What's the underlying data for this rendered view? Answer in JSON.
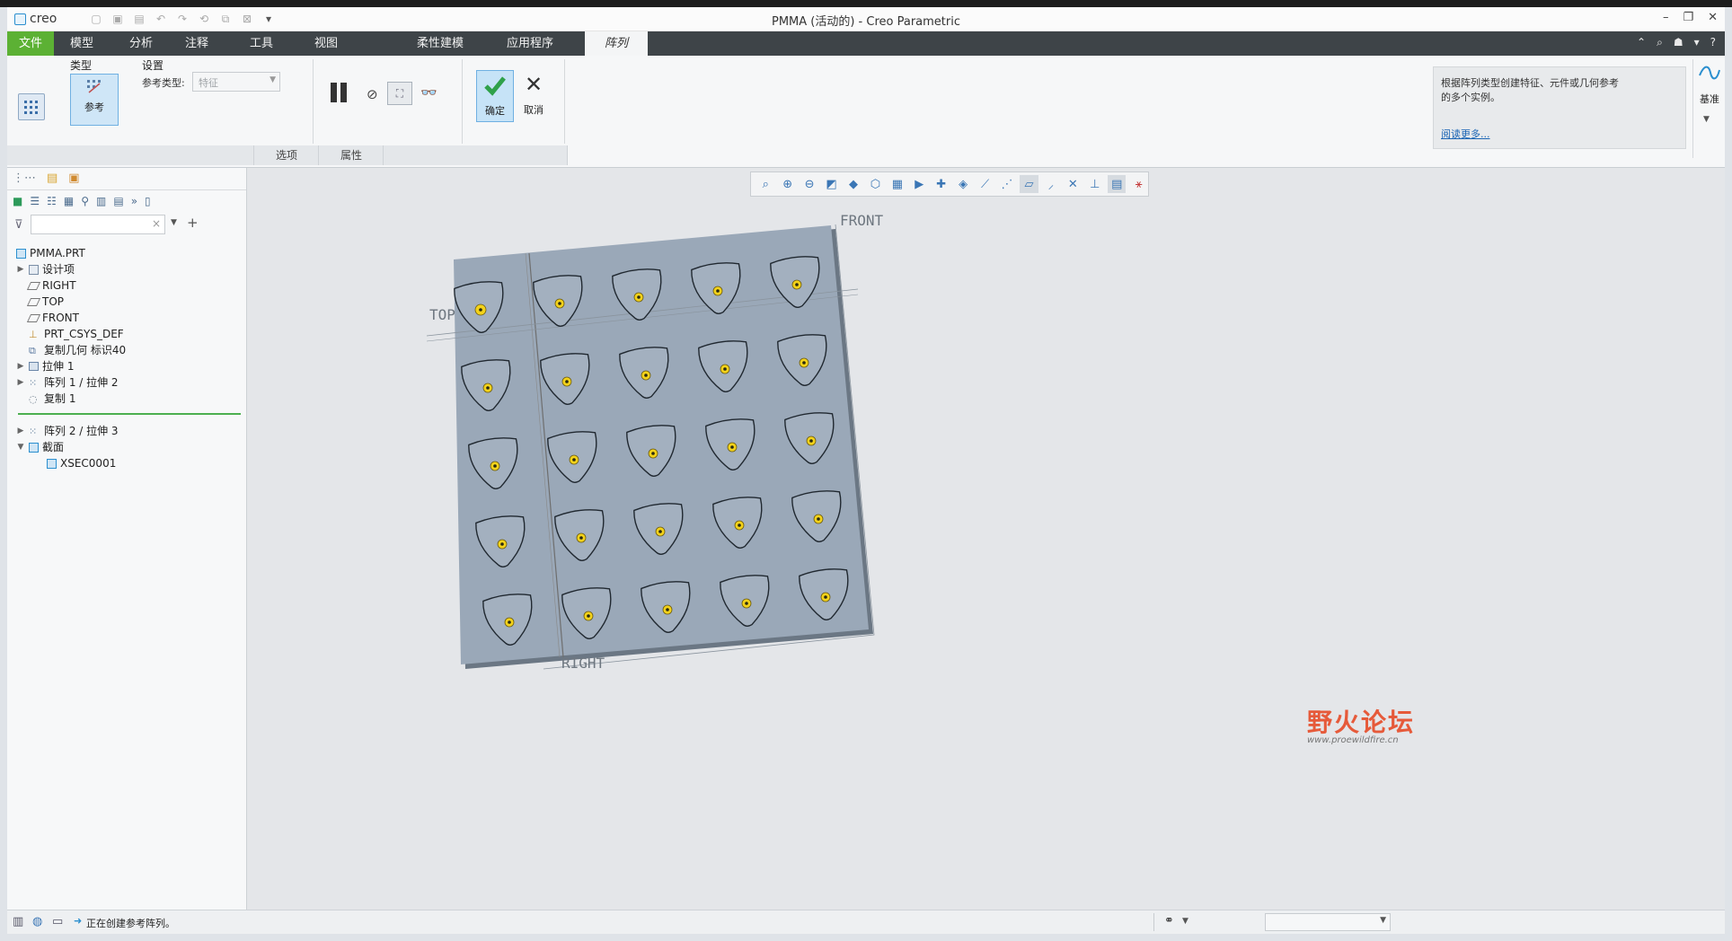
{
  "app": {
    "logo": "creo",
    "window_title": "PMMA (活动的) - Creo Parametric"
  },
  "tabs": [
    {
      "label": "文件"
    },
    {
      "label": "模型"
    },
    {
      "label": "分析"
    },
    {
      "label": "注释"
    },
    {
      "label": "工具"
    },
    {
      "label": "视图"
    },
    {
      "label": "柔性建模"
    },
    {
      "label": "应用程序"
    },
    {
      "label": "阵列"
    }
  ],
  "ribbon": {
    "type_label": "类型",
    "type_button": "参考",
    "settings_label": "设置",
    "ref_type_label": "参考类型:",
    "ref_type_value": "特征",
    "ok_label": "确定",
    "cancel_label": "取消",
    "options_tab": "选项",
    "properties_tab": "属性",
    "info_text": "根据阵列类型创建特征、元件或几何参考的多个实例。",
    "read_more": "阅读更多...",
    "datum_label": "基准"
  },
  "tree": {
    "search_placeholder": "",
    "items": [
      {
        "label": "PMMA.PRT"
      },
      {
        "label": "设计项"
      },
      {
        "label": "RIGHT"
      },
      {
        "label": "TOP"
      },
      {
        "label": "FRONT"
      },
      {
        "label": "PRT_CSYS_DEF"
      },
      {
        "label": "复制几何 标识40"
      },
      {
        "label": "拉伸 1"
      },
      {
        "label": "阵列 1 / 拉伸 2"
      },
      {
        "label": "复制 1"
      },
      {
        "label": "阵列 2 / 拉伸 3"
      },
      {
        "label": "截面"
      },
      {
        "label": "XSEC0001"
      }
    ]
  },
  "graphics": {
    "datum_front": "FRONT",
    "datum_top": "TOP",
    "datum_right": "RIGHT",
    "pattern_rows": 5,
    "pattern_cols": 5,
    "plate_color": "#9aa8b8",
    "marker_color": "#f3d21a"
  },
  "status": {
    "message": "正在创建参考阵列。"
  },
  "watermark": {
    "title": "野火论坛",
    "url": "www.proewildfire.cn"
  },
  "colors": {
    "file_tab": "#5cb134",
    "tab_bar": "#3e4448",
    "accent": "#2b8fcf"
  }
}
